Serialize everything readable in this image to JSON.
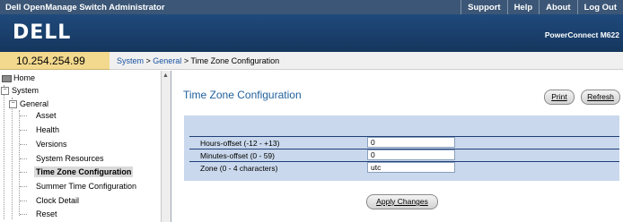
{
  "app": {
    "title": "Dell OpenManage Switch Administrator",
    "nav": [
      "Support",
      "Help",
      "About",
      "Log Out"
    ],
    "logo": "DELL",
    "model": "PowerConnect M622"
  },
  "address": "10.254.254.99",
  "breadcrumb": {
    "system": "System",
    "sep1": " > ",
    "general": "General",
    "sep2": " > ",
    "current": "Time Zone Configuration"
  },
  "tree": {
    "home": "Home",
    "system": "System",
    "general": "General",
    "asset": "Asset",
    "health": "Health",
    "versions": "Versions",
    "system_resources": "System Resources",
    "time_zone": "Time Zone Configuration",
    "summer_time": "Summer Time Configuration",
    "clock_detail": "Clock Detail",
    "reset": "Reset"
  },
  "page": {
    "title": "Time Zone Configuration",
    "print": "Print",
    "refresh": "Refresh",
    "apply": "Apply Changes"
  },
  "fields": {
    "hours_label": "Hours-offset (-12 - +13)",
    "hours_value": "0",
    "minutes_label": "Minutes-offset (0 - 59)",
    "minutes_value": "0",
    "zone_label": "Zone (0 - 4 characters)",
    "zone_value": "utc"
  },
  "colors": {
    "topbar": "#3b5676",
    "banner": "#1f4a7c",
    "address_bg": "#f3d98e",
    "panel": "#c9d8ec",
    "title": "#1e5f9c"
  }
}
